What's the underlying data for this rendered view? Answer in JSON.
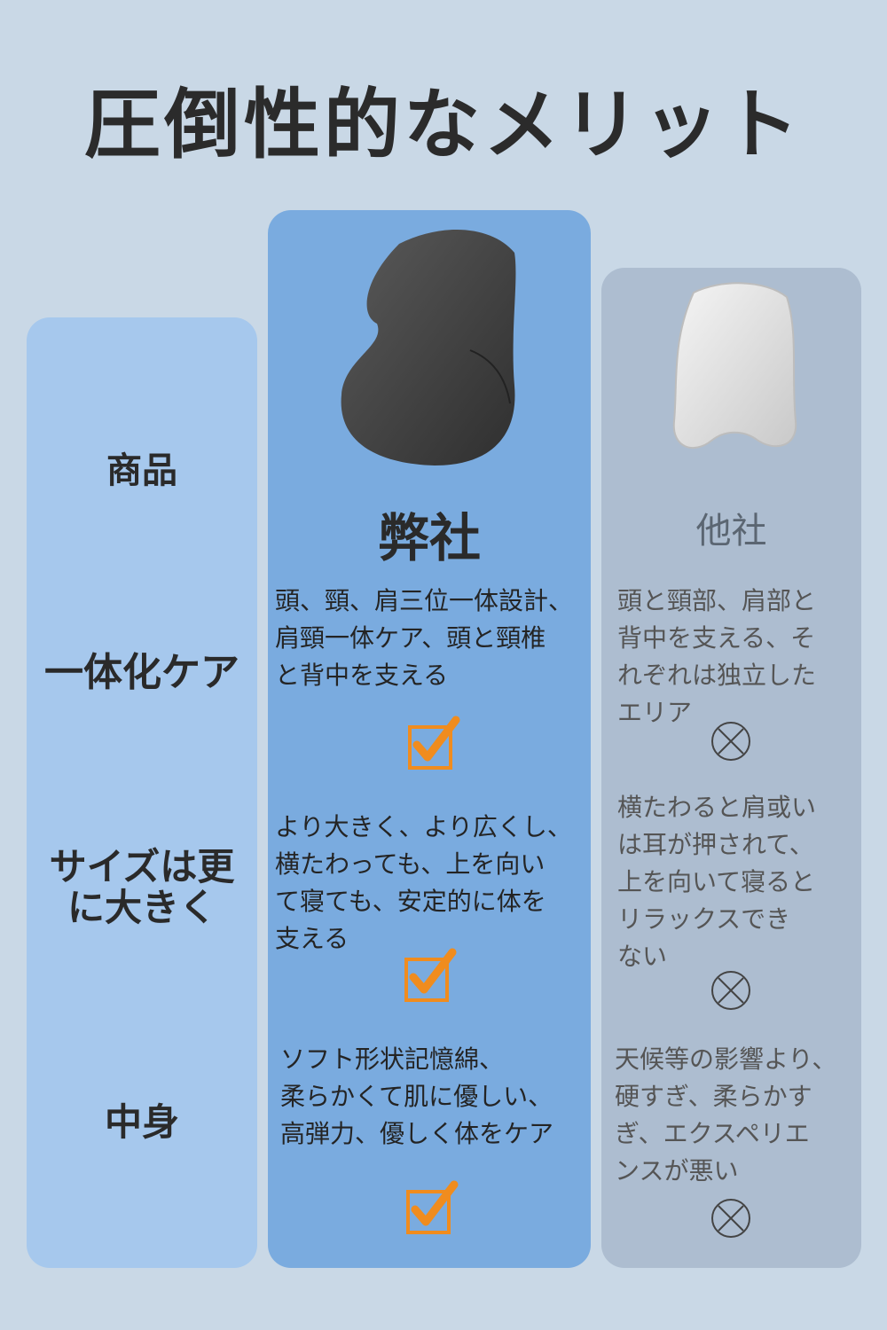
{
  "title": "圧倒性的なメリット",
  "row_labels": {
    "product": "商品",
    "care": "一体化ケア",
    "size_line1": "サイズは更",
    "size_line2": "に大きく",
    "filling": "中身"
  },
  "brands": {
    "ours": "弊社",
    "other": "他社"
  },
  "ours": {
    "care": "頭、頸、肩三位一体設計、\n肩頸一体ケア、頭と頸椎\nと背中を支える",
    "size": "より大きく、より広くし、\n横たわっても、上を向い\nて寝ても、安定的に体を\n支える",
    "filling": "ソフト形状記憶綿、\n柔らかくて肌に優しい、\n高弾力、優しく体をケア"
  },
  "other": {
    "care": "頭と頸部、肩部と\n背中を支える、そ\nれぞれは独立した\nエリア",
    "size": "横たわると肩或い\nは耳が押されて、\n上を向いて寝ると\nリラックスでき\nない",
    "filling": "天候等の影響より、\n硬すぎ、柔らかす\nぎ、エクスペリエ\nンスが悪い"
  },
  "icons": {
    "check": "check-box-icon",
    "cross": "circle-x-icon"
  },
  "colors": {
    "background": "#c9d8e6",
    "labels_column": "#a6c8ed",
    "ours_column": "#7aabdf",
    "other_column": "#adbdd0",
    "check": "#f08c1e"
  }
}
